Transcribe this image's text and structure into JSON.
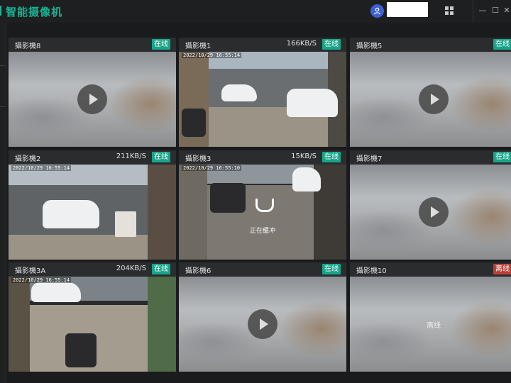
{
  "app": {
    "title": "智能摄像机"
  },
  "window_controls": {
    "minimize": "—",
    "maximize": "☐",
    "close": "✕"
  },
  "cameras": [
    {
      "name": "攝影機8",
      "bitrate": "",
      "status": "在线",
      "overlay": "play",
      "timestamp": ""
    },
    {
      "name": "攝影機1",
      "bitrate": "166KB/S",
      "status": "在线",
      "overlay": "",
      "timestamp": "2022/10/29 16:55:14"
    },
    {
      "name": "攝影機5",
      "bitrate": "",
      "status": "在线",
      "overlay": "play",
      "timestamp": ""
    },
    {
      "name": "攝影機2",
      "bitrate": "211KB/S",
      "status": "在线",
      "overlay": "",
      "timestamp": "2022/10/29 16:55:14"
    },
    {
      "name": "攝影機3",
      "bitrate": "15KB/S",
      "status": "在线",
      "overlay": "buffering",
      "overlay_text": "正在缓冲",
      "timestamp": "2022/10/29 16:55:10"
    },
    {
      "name": "攝影機7",
      "bitrate": "",
      "status": "在线",
      "overlay": "play",
      "timestamp": ""
    },
    {
      "name": "攝影機3A",
      "bitrate": "204KB/S",
      "status": "在线",
      "overlay": "",
      "timestamp": "2022/10/29 16:55:14"
    },
    {
      "name": "攝影機6",
      "bitrate": "",
      "status": "在线",
      "overlay": "play",
      "timestamp": ""
    },
    {
      "name": "攝影機10",
      "bitrate": "",
      "status": "离线",
      "overlay": "offline",
      "overlay_text": "离线",
      "timestamp": ""
    }
  ],
  "colors": {
    "accent": "#19b394",
    "online": "#17a58a",
    "offline": "#b84038",
    "avatar": "#3d5fd6"
  }
}
